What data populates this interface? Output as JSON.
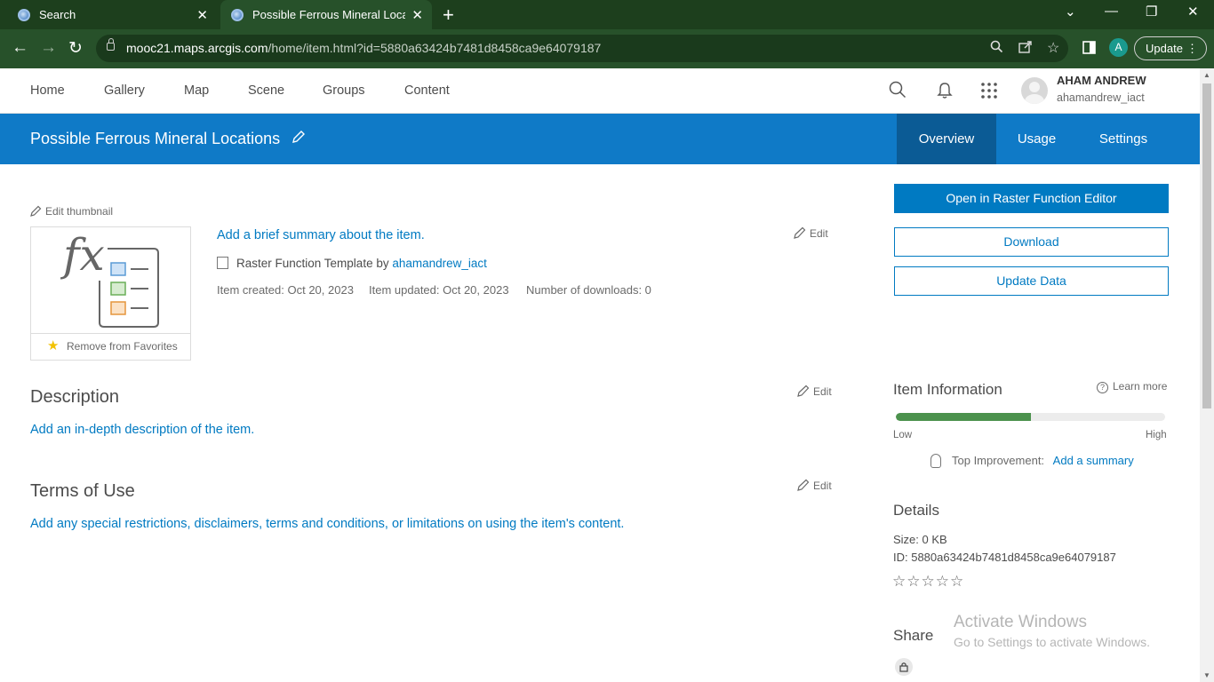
{
  "browser": {
    "tabs": [
      {
        "title": "Search",
        "close": "✕"
      },
      {
        "title": "Possible Ferrous Mineral Locatio",
        "close": "✕"
      }
    ],
    "new_tab": "+",
    "window_controls": {
      "collapse": "⌄",
      "minimize": "—",
      "restore": "❐",
      "close": "✕"
    },
    "nav": {
      "back": "←",
      "forward": "→",
      "reload": "↻"
    },
    "url_host": "mooc21.maps.arcgis.com",
    "url_path": "/home/item.html?id=5880a63424b7481d8458ca9e64079187",
    "profile_initial": "A",
    "update_label": "Update",
    "update_menu": "⋮"
  },
  "header": {
    "nav": [
      "Home",
      "Gallery",
      "Map",
      "Scene",
      "Groups",
      "Content"
    ],
    "user_name": "AHAM ANDREW",
    "user_id": "ahamandrew_iact",
    "icons": [
      "search-icon",
      "notifications-bell-icon",
      "app-launcher-icon"
    ]
  },
  "banner": {
    "title": "Possible Ferrous Mineral Locations",
    "tabs": [
      "Overview",
      "Usage",
      "Settings"
    ],
    "active_tab": "Overview",
    "color": "#0f7ac7"
  },
  "main": {
    "edit_thumbnail": "Edit thumbnail",
    "favorites_label": "Remove from Favorites",
    "summary_link": "Add a brief summary about the item.",
    "edit_label": "Edit",
    "item_type": "Raster Function Template by",
    "owner": "ahamandrew_iact",
    "created": "Item created: Oct 20, 2023",
    "updated": "Item updated: Oct 20, 2023",
    "downloads": "Number of downloads: 0",
    "description_heading": "Description",
    "description_link": "Add an in-depth description of the item.",
    "terms_heading": "Terms of Use",
    "terms_link": "Add any special restrictions, disclaimers, terms and conditions, or limitations on using the item's content."
  },
  "sidebar": {
    "open_editor": "Open in Raster Function Editor",
    "download": "Download",
    "update_data": "Update Data",
    "item_info_heading": "Item Information",
    "learn_more": "Learn more",
    "score_fraction": 0.5,
    "low": "Low",
    "high": "High",
    "top_improvement": "Top Improvement:",
    "top_improvement_link": "Add a summary",
    "details_heading": "Details",
    "size": "Size: 0 KB",
    "id": "ID: 5880a63424b7481d8458ca9e64079187",
    "rating_stars": "☆☆☆☆☆",
    "rating_value": 0,
    "share_heading": "Share",
    "accent": "#007ac2",
    "meter_color": "#4c924d"
  },
  "watermark": {
    "line1": "Activate Windows",
    "line2": "Go to Settings to activate Windows."
  }
}
